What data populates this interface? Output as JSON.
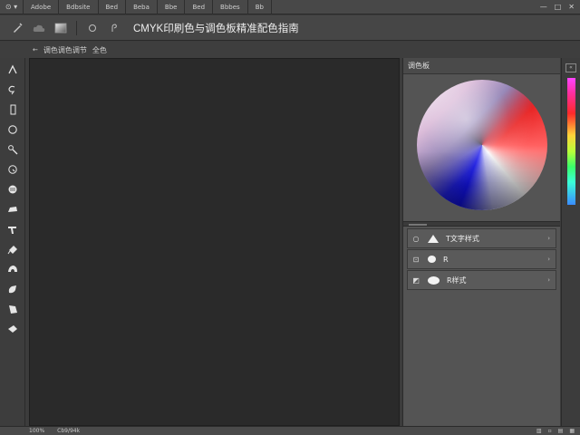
{
  "menubar": {
    "logo": "⊙ ▾",
    "items": [
      "Adobe",
      "Bdbsite",
      "Bed",
      "Beba",
      "Bbe",
      "Bed",
      "Bbbes",
      "Bb"
    ],
    "window_controls": [
      "—",
      "□",
      "✕"
    ]
  },
  "options_bar": {
    "tool_icon": "brush-icon",
    "doc_title": "CMYK印刷色与调色板精准配色指南"
  },
  "tab": {
    "back": "←",
    "label": "调色调色调节",
    "sub": "全色"
  },
  "right_panel": {
    "color_title": "调色板",
    "layers": [
      {
        "name": "T文字样式",
        "shape": "triangle"
      },
      {
        "name": "R",
        "shape": "dot"
      },
      {
        "name": "R样式",
        "shape": "oval"
      }
    ]
  },
  "strip": {
    "handle": "«"
  },
  "statusbar": {
    "zoom": "100%",
    "info": "Cb9/94k"
  },
  "colors": {
    "background": "#3c3c3c",
    "canvas": "#2a2a2a",
    "panel": "#545454"
  }
}
